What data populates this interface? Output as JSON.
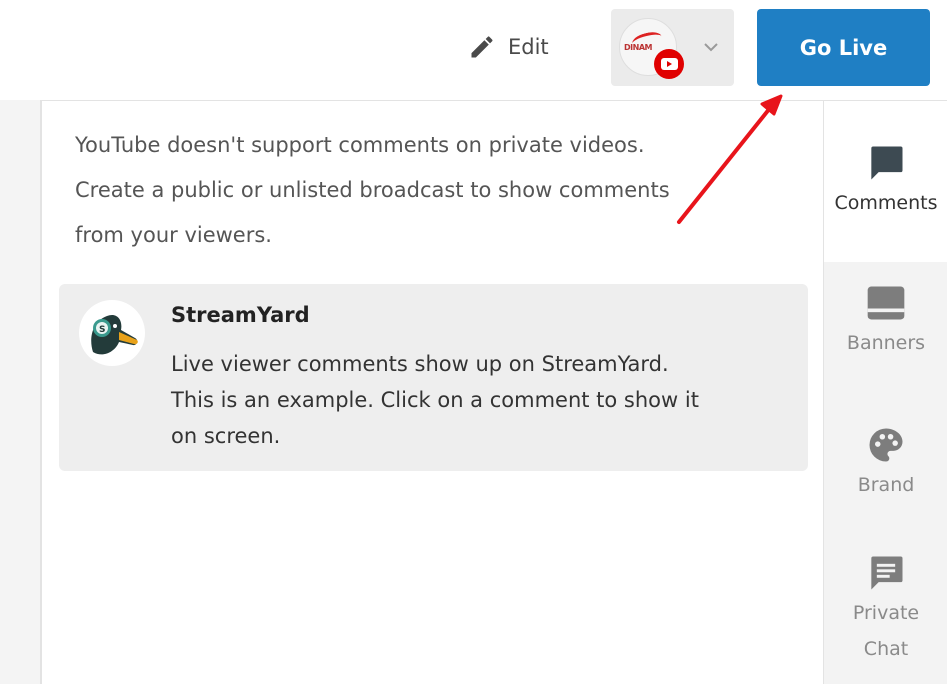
{
  "header": {
    "edit_label": "Edit",
    "account_avatar_text": "DINAM",
    "go_live_label": "Go Live"
  },
  "comments_panel": {
    "notice_lines": [
      "YouTube doesn't support comments on private videos.",
      "Create a public or unlisted broadcast to show comments",
      "from your viewers."
    ],
    "sample_comment": {
      "author": "StreamYard",
      "text_lines": [
        "Live viewer comments show up on StreamYard.",
        "This is an example. Click on a comment to show it",
        "on screen."
      ]
    }
  },
  "sidebar": {
    "items": [
      {
        "label": "Comments",
        "icon": "comment-icon",
        "active": true
      },
      {
        "label": "Banners",
        "icon": "banner-icon",
        "active": false
      },
      {
        "label": "Brand",
        "icon": "palette-icon",
        "active": false
      },
      {
        "label": "Private",
        "label2": "Chat",
        "icon": "private-chat-icon",
        "active": false
      }
    ]
  },
  "colors": {
    "go_live_bg": "#1f7fc4",
    "sidebar_bg": "#f3f3f3",
    "comment_card_bg": "#eeeeee",
    "annotation_arrow": "#e8141b",
    "youtube_red": "#e00000"
  }
}
